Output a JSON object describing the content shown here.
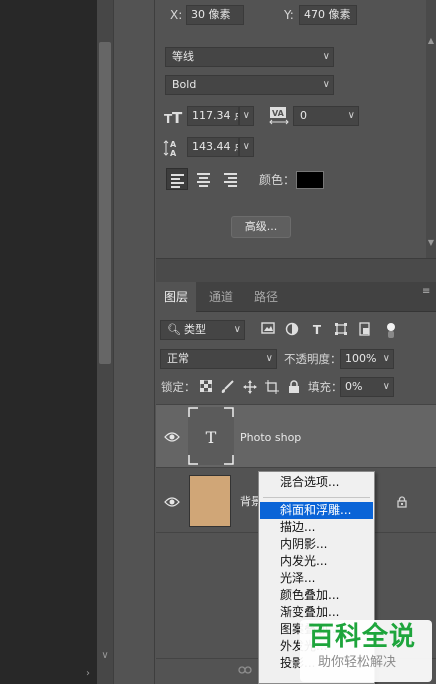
{
  "position": {
    "x_label": "X:",
    "x_value": "30 像素",
    "y_label": "Y:",
    "y_value": "470 像素"
  },
  "character": {
    "font_family": "等线",
    "font_style": "Bold",
    "font_size": "117.34 点",
    "tracking": "0",
    "leading": "143.44 点",
    "color_label": "颜色：",
    "color_value": "#000000",
    "advanced_button": "高级..."
  },
  "layers_panel": {
    "tabs": [
      {
        "label": "图层",
        "active": true
      },
      {
        "label": "通道",
        "active": false
      },
      {
        "label": "路径",
        "active": false
      }
    ],
    "filter_kind": "类型",
    "blend_mode": "正常",
    "opacity_label": "不透明度：",
    "opacity_value": "100%",
    "lock_label": "锁定：",
    "fill_label": "填充：",
    "fill_value": "0%",
    "layers": [
      {
        "name": "Photo shop",
        "thumb": "T",
        "selected": true,
        "visible": true
      },
      {
        "name": "背景",
        "visible": true,
        "locked": true,
        "thumb_color": "#d0a677"
      }
    ]
  },
  "context_menu": {
    "items": [
      {
        "label": "混合选项...",
        "highlighted": false
      },
      {
        "label": "斜面和浮雕...",
        "highlighted": true
      },
      {
        "label": "描边...",
        "highlighted": false
      },
      {
        "label": "内阴影...",
        "highlighted": false
      },
      {
        "label": "内发光...",
        "highlighted": false
      },
      {
        "label": "光泽...",
        "highlighted": false
      },
      {
        "label": "颜色叠加...",
        "highlighted": false
      },
      {
        "label": "渐变叠加...",
        "highlighted": false
      },
      {
        "label": "图案叠加...",
        "highlighted": false
      },
      {
        "label": "外发光...",
        "highlighted": false
      },
      {
        "label": "投影...",
        "highlighted": false
      }
    ]
  },
  "watermark": {
    "main": "百科全说",
    "sub": "助你轻松解决"
  }
}
